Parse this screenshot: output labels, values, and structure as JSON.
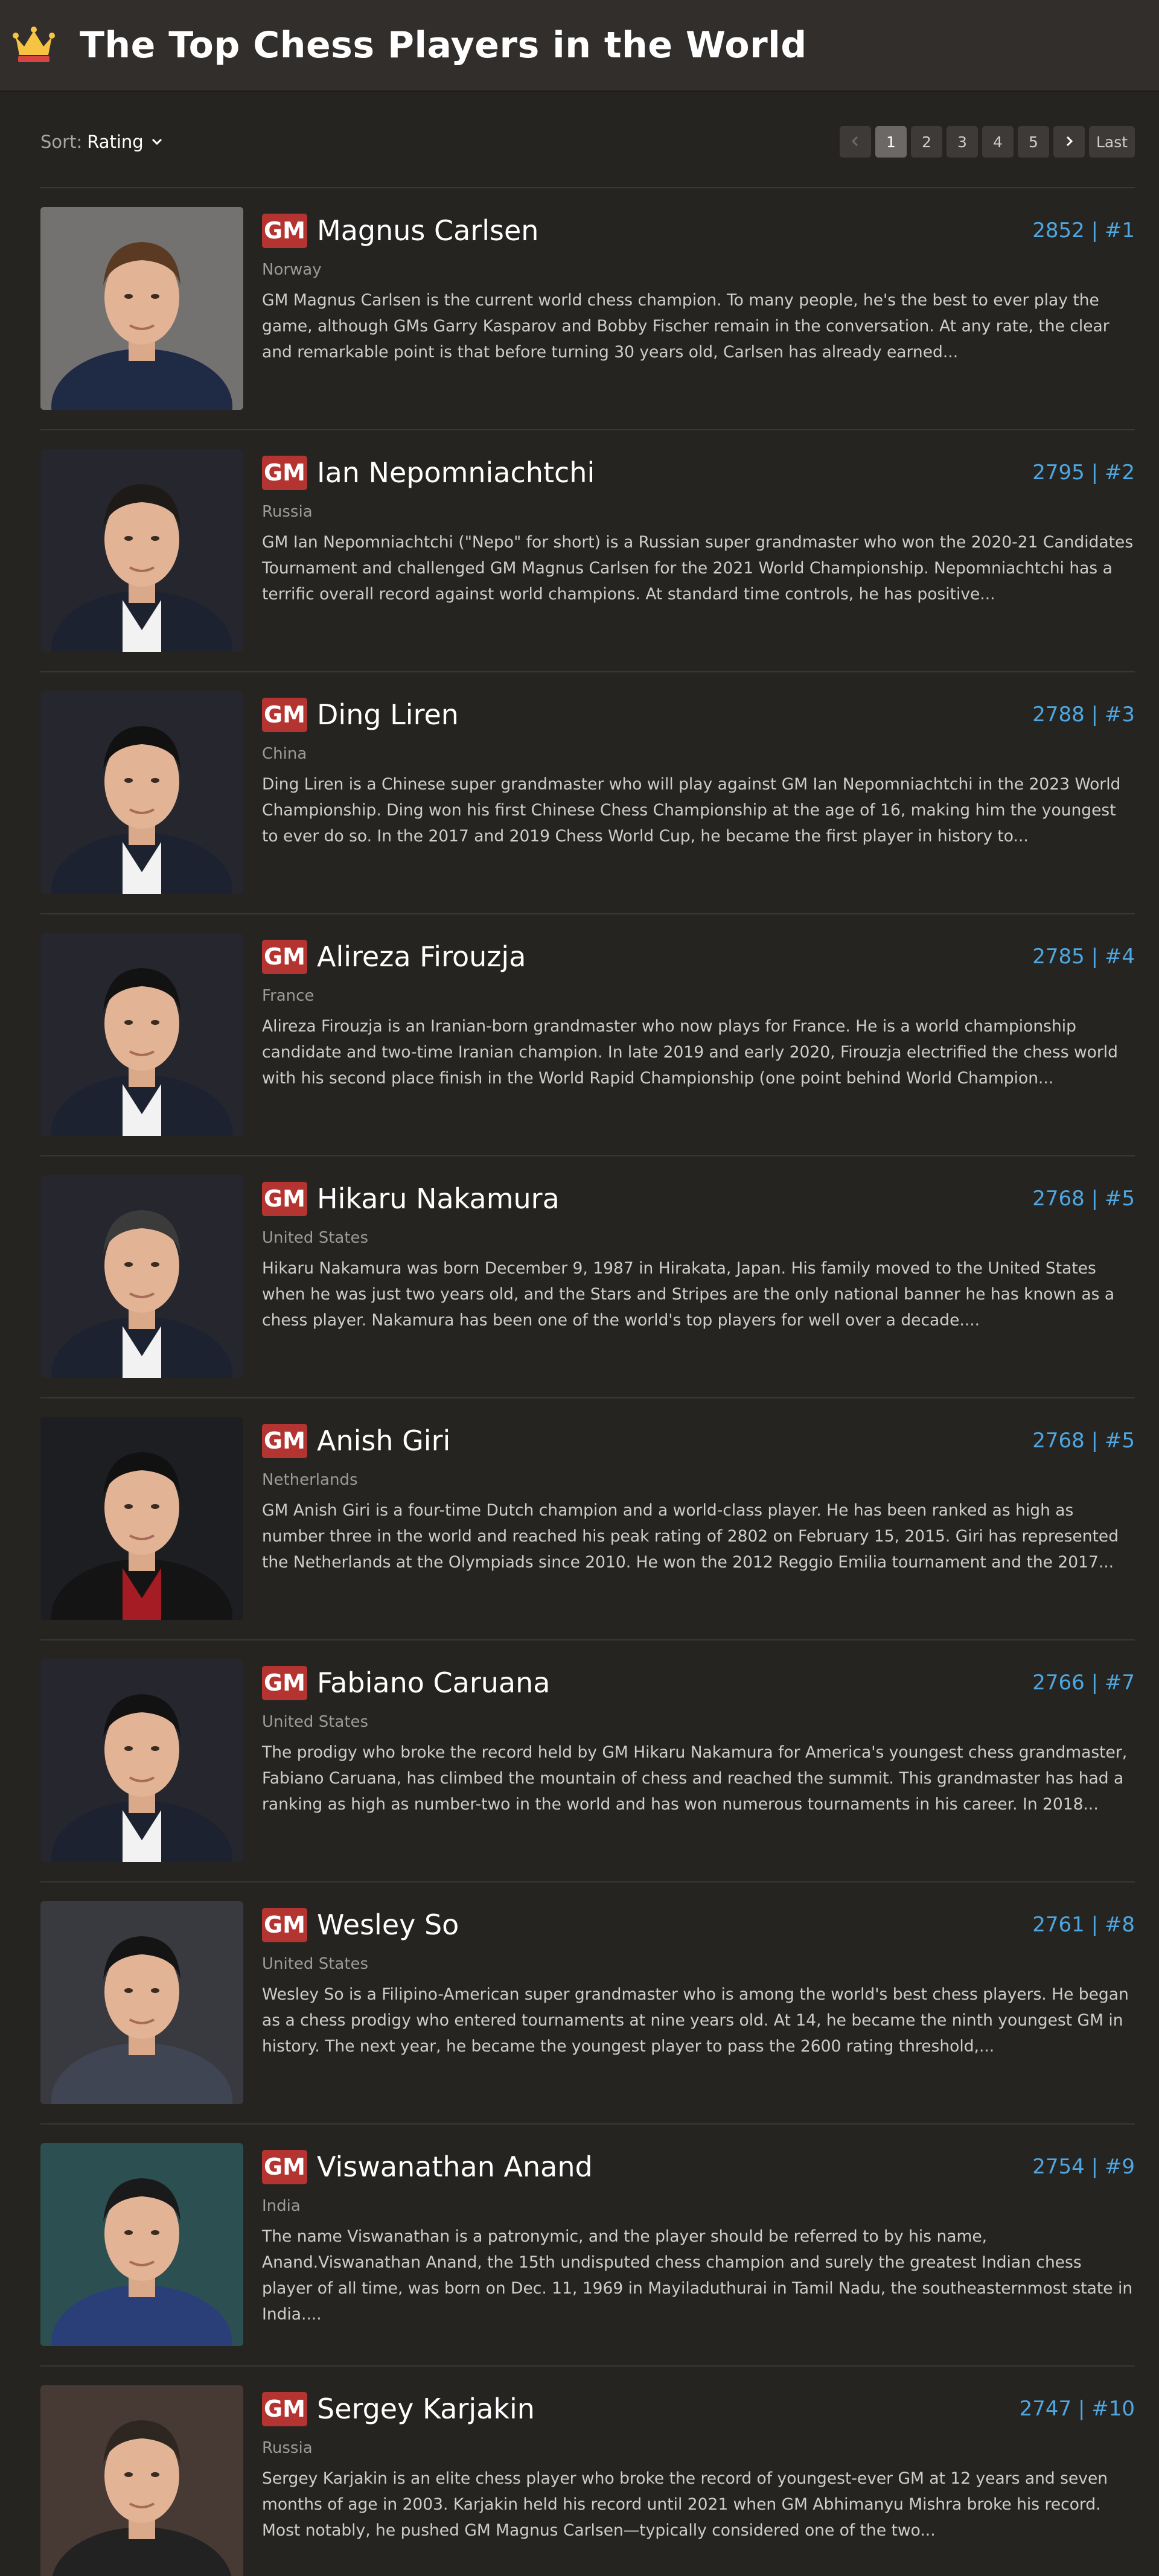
{
  "header": {
    "title": "The Top Chess Players in the World",
    "icon": "crown-icon",
    "accent": "#f6c343"
  },
  "toolbar": {
    "sort_label": "Sort:",
    "sort_value": "Rating",
    "pagination": {
      "prev": "‹",
      "pages": [
        "1",
        "2",
        "3",
        "4",
        "5"
      ],
      "current": "1",
      "next": "›",
      "last": "Last"
    }
  },
  "colors": {
    "badge": "#b33430",
    "rating": "#4ea7e0",
    "background": "#262421"
  },
  "players": [
    {
      "title": "GM",
      "name": "Magnus Carlsen",
      "rating": "2852 | #1",
      "country": "Norway",
      "bio": "GM Magnus Carlsen is the current world chess champion. To many people, he's the best to ever play the game, although GMs Garry Kasparov and Bobby Fischer remain in the conversation. At any rate, the clear and remarkable point is that before turning 30 years old, Carlsen has already earned..."
    },
    {
      "title": "GM",
      "name": "Ian Nepomniachtchi",
      "rating": "2795 | #2",
      "country": "Russia",
      "bio": "GM Ian Nepomniachtchi (\"Nepo\" for short) is a Russian super grandmaster who won the 2020-21 Candidates Tournament and challenged GM Magnus Carlsen for the 2021 World Championship. Nepomniachtchi has a terrific overall record against world champions. At standard time controls, he has positive..."
    },
    {
      "title": "GM",
      "name": "Ding Liren",
      "rating": "2788 | #3",
      "country": "China",
      "bio": "Ding Liren is a Chinese super grandmaster who will play against GM Ian Nepomniachtchi in the 2023 World Championship. Ding won his first Chinese Chess Championship at the age of 16, making him the youngest to ever do so. In the 2017 and 2019 Chess World Cup, he became the first player in history to..."
    },
    {
      "title": "GM",
      "name": "Alireza Firouzja",
      "rating": "2785 | #4",
      "country": "France",
      "bio": "Alireza Firouzja is an Iranian-born grandmaster who now plays for France. He is a world championship candidate and two-time Iranian champion. In late 2019 and early 2020, Firouzja electrified the chess world with his second place finish in the World Rapid Championship (one point behind World Champion..."
    },
    {
      "title": "GM",
      "name": "Hikaru Nakamura",
      "rating": "2768 | #5",
      "country": "United States",
      "bio": "Hikaru Nakamura was born December 9, 1987 in Hirakata, Japan. His family moved to the United States when he was just two years old, and the Stars and Stripes are the only national banner he has known as a chess player.  Nakamura has been one of the world's top players for well over a decade...."
    },
    {
      "title": "GM",
      "name": "Anish Giri",
      "rating": "2768 | #5",
      "country": "Netherlands",
      "bio": "GM Anish Giri is a four-time Dutch champion and a world-class player. He has been ranked as high as number three in the world and reached his peak rating of 2802 on February 15, 2015. Giri has represented the Netherlands at the Olympiads since 2010. He won the 2012 Reggio Emilia tournament and the 2017..."
    },
    {
      "title": "GM",
      "name": "Fabiano Caruana",
      "rating": "2766 | #7",
      "country": "United States",
      "bio": "The prodigy who broke the record held by GM Hikaru Nakamura for America's youngest chess grandmaster, Fabiano Caruana, has climbed the mountain of chess and reached the summit. This grandmaster has had a ranking as high as number-two in the world and has won numerous tournaments in his career. In 2018..."
    },
    {
      "title": "GM",
      "name": "Wesley So",
      "rating": "2761 | #8",
      "country": "United States",
      "bio": "Wesley So is a Filipino-American super grandmaster who is among the world's best chess players. He began as a chess prodigy who entered tournaments at nine years old. At 14, he became the ninth youngest GM in history. The next year, he became the youngest player to pass the 2600 rating threshold,..."
    },
    {
      "title": "GM",
      "name": "Viswanathan Anand",
      "rating": "2754 | #9",
      "country": "India",
      "bio": "The name Viswanathan is a patronymic, and the player should be referred to by his name, Anand.Viswanathan Anand, the 15th undisputed chess champion and surely the greatest Indian chess player of all time, was born on Dec. 11, 1969 in Mayiladuthurai in Tamil Nadu, the southeasternmost state in India...."
    },
    {
      "title": "GM",
      "name": "Sergey Karjakin",
      "rating": "2747 | #10",
      "country": "Russia",
      "bio": "Sergey Karjakin is an elite chess player who broke the record of youngest-ever GM at 12 years and seven months of age in 2003. Karjakin held his record until 2021 when GM Abhimanyu Mishra broke his record. Most notably, he pushed GM Magnus Carlsen—typically considered one of the two..."
    }
  ]
}
